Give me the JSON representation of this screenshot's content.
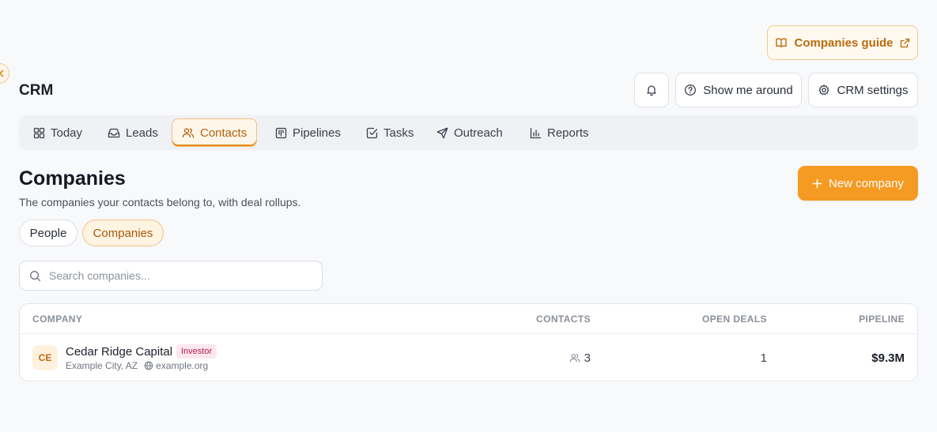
{
  "header": {
    "guide_label": "Companies guide",
    "app_title": "CRM",
    "tour_label": "Show me around",
    "settings_label": "CRM settings"
  },
  "nav": {
    "tabs": [
      {
        "label": "Today",
        "icon": "grid-icon",
        "active": false
      },
      {
        "label": "Leads",
        "icon": "inbox-icon",
        "active": false
      },
      {
        "label": "Contacts",
        "icon": "users-icon",
        "active": true
      },
      {
        "label": "Pipelines",
        "icon": "kanban-icon",
        "active": false
      },
      {
        "label": "Tasks",
        "icon": "check-square-icon",
        "active": false
      },
      {
        "label": "Outreach",
        "icon": "send-icon",
        "active": false
      },
      {
        "label": "Reports",
        "icon": "bar-chart-icon",
        "active": false
      }
    ]
  },
  "page": {
    "title": "Companies",
    "subtitle": "The companies your contacts belong to, with deal rollups.",
    "new_label": "New company"
  },
  "filters": {
    "people": "People",
    "companies": "Companies",
    "active": "Companies"
  },
  "search": {
    "placeholder": "Search companies...",
    "value": ""
  },
  "table": {
    "headers": {
      "company": "COMPANY",
      "contacts": "CONTACTS",
      "open_deals": "OPEN DEALS",
      "pipeline": "PIPELINE"
    },
    "rows": [
      {
        "initials": "CE",
        "name": "Cedar Ridge Capital",
        "badge": "Investor",
        "location": "Example City, AZ",
        "website": "example.org",
        "contacts": "3",
        "open_deals": "1",
        "pipeline": "$9.3M"
      }
    ]
  },
  "colors": {
    "accent": "#f59a23",
    "accent_text": "#b96b0c",
    "badge_bg": "#fde7ee",
    "badge_text": "#b31f4a"
  }
}
